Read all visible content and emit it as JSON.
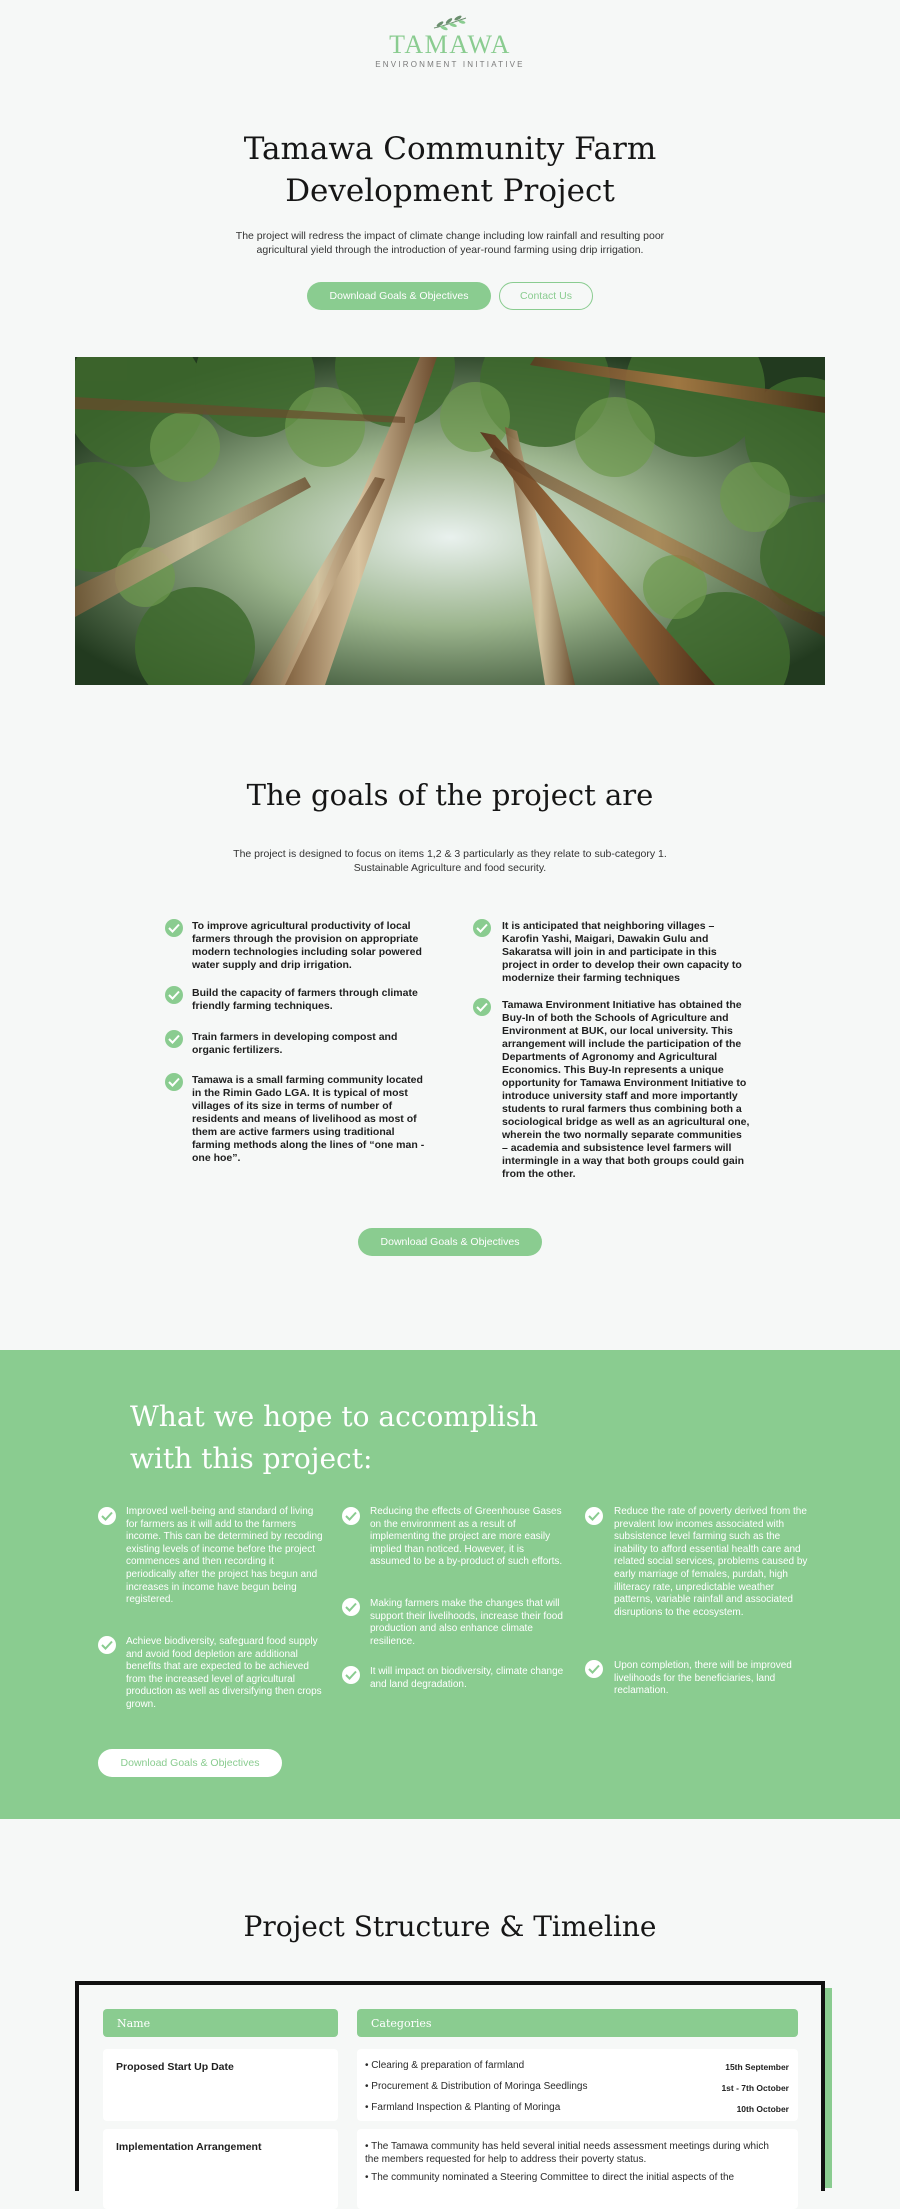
{
  "brand": {
    "name": "TAMAWA",
    "tagline": "ENVIRONMENT INITIATIVE",
    "accent_color": "#8acc90"
  },
  "hero": {
    "title": "Tamawa Community Farm Development Project",
    "subtitle": "The project will redress the impact of climate change including low rainfall and resulting poor agricultural yield through the introduction of year-round farming using drip irrigation.",
    "primary_button": "Download Goals & Objectives",
    "secondary_button": "Contact Us"
  },
  "goals": {
    "title": "The goals of the project are",
    "subtitle": "The project is designed to focus on items 1,2 & 3 particularly as they relate to sub-category 1. Sustainable Agriculture and food security.",
    "left_items": [
      "To improve agricultural productivity of local farmers through the provision on appropriate modern technologies including solar powered water supply and drip irrigation.",
      "Build the capacity of farmers through climate friendly farming techniques.",
      "Train farmers in developing compost and organic fertilizers.",
      "Tamawa is a small farming community located in the Rimin Gado LGA. It is typical of most villages of its size in terms of number of residents and means of livelihood as most of them are active farmers using traditional farming methods along the lines of “one man - one hoe”."
    ],
    "right_items": [
      "It is anticipated that neighboring villages – Karofin Yashi, Maigari, Dawakin Gulu and Sakaratsa will join in and participate in this project in order to develop their own capacity to modernize their farming techniques",
      "Tamawa Environment Initiative has obtained the Buy-In of both the Schools of Agriculture and Environment at BUK, our local university. This arrangement will include the participation of the Departments of Agronomy and Agricultural Economics. This Buy-In represents a unique opportunity for Tamawa Environment Initiative to introduce university staff and more importantly students to rural farmers thus combining both a sociological bridge as well as an agricultural one, wherein the two normally separate communities – academia and subsistence level farmers will intermingle in a way that both groups could gain from the other."
    ],
    "button": "Download Goals & Objectives"
  },
  "accomplish": {
    "title": "What we hope to accomplish with this project:",
    "col1": [
      "Improved well-being and standard of living for farmers as it will add to the farmers income. This can be determined by recoding existing levels of income before the project commences and then recording it periodically after the project has begun and increases in income have begun being registered.",
      "Achieve biodiversity, safeguard food supply and avoid food depletion are additional benefits that are expected to be achieved from the increased level of agricultural production as well as diversifying then crops grown."
    ],
    "col2": [
      "Reducing the effects of Greenhouse Gases on the environment as a result of implementing the project are more easily implied than noticed. However, it is assumed to be a by-product of such efforts.",
      "Making farmers make the changes that will support their livelihoods, increase their food production and also enhance climate resilience.",
      "It will impact on biodiversity, climate change and land degradation."
    ],
    "col3": [
      "Reduce the rate of poverty derived from the prevalent low incomes associated with subsistence level farming such as the inability to afford essential health care and related social services, problems caused by early marriage of females, purdah, high illiteracy rate, unpredictable weather patterns, variable rainfall and associated disruptions to the ecosystem.",
      "Upon completion, there will be improved livelihoods for the beneficiaries, land reclamation."
    ],
    "button": "Download Goals & Objectives"
  },
  "structure": {
    "title": "Project Structure & Timeline",
    "col_name": "Name",
    "col_categories": "Categories",
    "rows": [
      {
        "name": "Proposed Start Up Date",
        "items": [
          {
            "text": "Clearing & preparation of farmland",
            "date": "15th September"
          },
          {
            "text": "Procurement & Distribution of Moringa Seedlings",
            "date": "1st - 7th October"
          },
          {
            "text": "Farmland Inspection & Planting of Moringa",
            "date": "10th October"
          }
        ]
      },
      {
        "name": "Implementation Arrangement",
        "items": [
          {
            "text": "The Tamawa community has held several initial needs assessment meetings during which the members requested for help to address their poverty status.",
            "date": ""
          },
          {
            "text": "The community nominated a Steering Committee to direct the initial aspects of the",
            "date": ""
          }
        ]
      }
    ]
  }
}
